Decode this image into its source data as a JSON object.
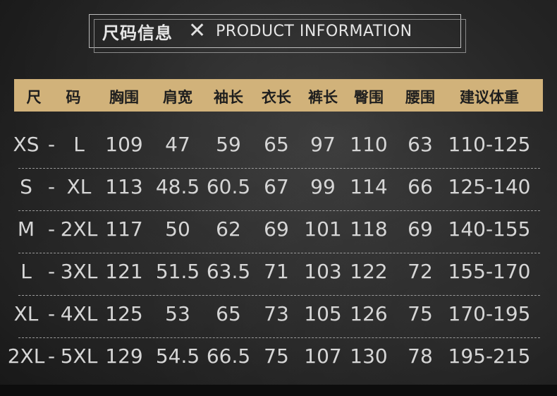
{
  "title": {
    "cn": "尺码信息",
    "icon": "x-mark-icon",
    "en": "PRODUCT INFORMATION"
  },
  "headers": [
    "尺",
    "码",
    "胸围",
    "肩宽",
    "袖长",
    "衣长",
    "裤长",
    "臀围",
    "腰围",
    "建议体重"
  ],
  "rows": [
    [
      "XS",
      "-",
      "L",
      "109",
      "47",
      "59",
      "65",
      "97",
      "110",
      "63",
      "110-125"
    ],
    [
      "S",
      "-",
      "XL",
      "113",
      "48.5",
      "60.5",
      "67",
      "99",
      "114",
      "66",
      "125-140"
    ],
    [
      "M",
      "-",
      "2XL",
      "117",
      "50",
      "62",
      "69",
      "101",
      "118",
      "69",
      "140-155"
    ],
    [
      "L",
      "-",
      "3XL",
      "121",
      "51.5",
      "63.5",
      "71",
      "103",
      "122",
      "72",
      "155-170"
    ],
    [
      "XL",
      "-",
      "4XL",
      "125",
      "53",
      "65",
      "73",
      "105",
      "126",
      "75",
      "170-195"
    ],
    [
      "2XL",
      "-",
      "5XL",
      "129",
      "54.5",
      "66.5",
      "75",
      "107",
      "130",
      "78",
      "195-215"
    ]
  ],
  "colors": {
    "header_bg": "#d1b27a",
    "header_text": "#1e1e1e",
    "body_text": "#d6d6d6",
    "background": "#262626"
  }
}
